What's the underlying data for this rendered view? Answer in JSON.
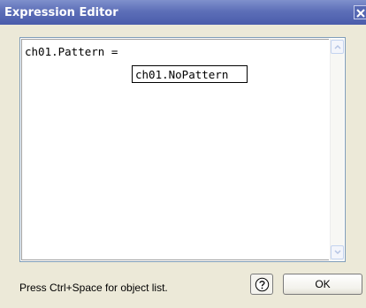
{
  "window": {
    "title": "Expression Editor"
  },
  "editor": {
    "code_line": "ch01.Pattern =",
    "autocomplete_item": "ch01.NoPattern"
  },
  "footer": {
    "hint": "Press Ctrl+Space for object list.",
    "ok_label": "OK"
  },
  "icons": {
    "close": "close-icon",
    "help": "help-icon",
    "scroll_up": "scroll-up-arrow-icon",
    "scroll_down": "scroll-down-arrow-icon"
  },
  "colors": {
    "titlebar": "#5d6fb8",
    "window_bg": "#ece9d8",
    "editor_border": "#7f9db9"
  }
}
